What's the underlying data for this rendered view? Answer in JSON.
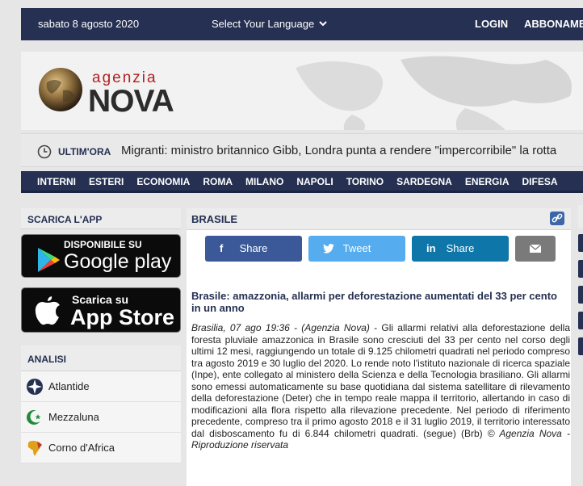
{
  "topbar": {
    "date": "sabato 8 agosto 2020",
    "language": "Select Your Language",
    "login": "LOGIN",
    "subscribe": "ABBONAMENTI"
  },
  "logo": {
    "agenzia": "agenzia",
    "nova": "NOVA"
  },
  "ticker": {
    "label": "ULTIM'ORA",
    "text": "Migranti: ministro britannico Gibb, Londra punta a rendere \"impercorribile\" la rotta"
  },
  "nav": [
    "INTERNI",
    "ESTERI",
    "ECONOMIA",
    "ROMA",
    "MILANO",
    "NAPOLI",
    "TORINO",
    "SARDEGNA",
    "ENERGIA",
    "DIFESA"
  ],
  "sidebar": {
    "app_title": "SCARICA L'APP",
    "google": {
      "small": "DISPONIBILE SU",
      "big": "Google play"
    },
    "apple": {
      "small": "Scarica su",
      "big": "App Store"
    },
    "analisi_title": "ANALISI",
    "items": [
      "Atlantide",
      "Mezzaluna",
      "Corno d'Africa"
    ]
  },
  "section": {
    "title": "BRASILE"
  },
  "share": {
    "facebook": "Share",
    "twitter": "Tweet",
    "linkedin": "Share"
  },
  "article": {
    "headline": "Brasile: amazzonia, allarmi per deforestazione aumentati del 33 per cento in un anno",
    "dateline": "Brasilia, 07 ago 19:36 - (Agenzia Nova)",
    "body": " - Gli allarmi relativi alla deforestazione della foresta pluviale amazzonica in Brasile sono cresciuti del 33 per cento nel corso degli ultimi 12 mesi, raggiungendo un totale di 9.125 chilometri quadrati nel periodo compreso tra agosto 2019 e 30 luglio del 2020. Lo rende noto l'istituto nazionale di ricerca spaziale (Inpe), ente collegato al ministero della Scienza e della Tecnologia brasiliano. Gli allarmi sono emessi automaticamente su base quotidiana dal sistema satellitare di rilevamento della deforestazione (Deter) che in tempo reale mappa il territorio, allertando in caso di modificazioni alla flora rispetto alla rilevazione precedente. Nel periodo di riferimento precedente, compreso tra il primo agosto 2018 e il 31 luglio 2019, il territorio interessato dal disboscamento fu di 6.844 chilometri quadrati. (segue) (Brb) ",
    "copyright": "© Agenzia Nova - Riproduzione riservata"
  },
  "colors": {
    "navy": "#253052",
    "facebook": "#3b5998",
    "twitter": "#55acee",
    "linkedin": "#0e76a8",
    "email": "#7a7a7a"
  }
}
